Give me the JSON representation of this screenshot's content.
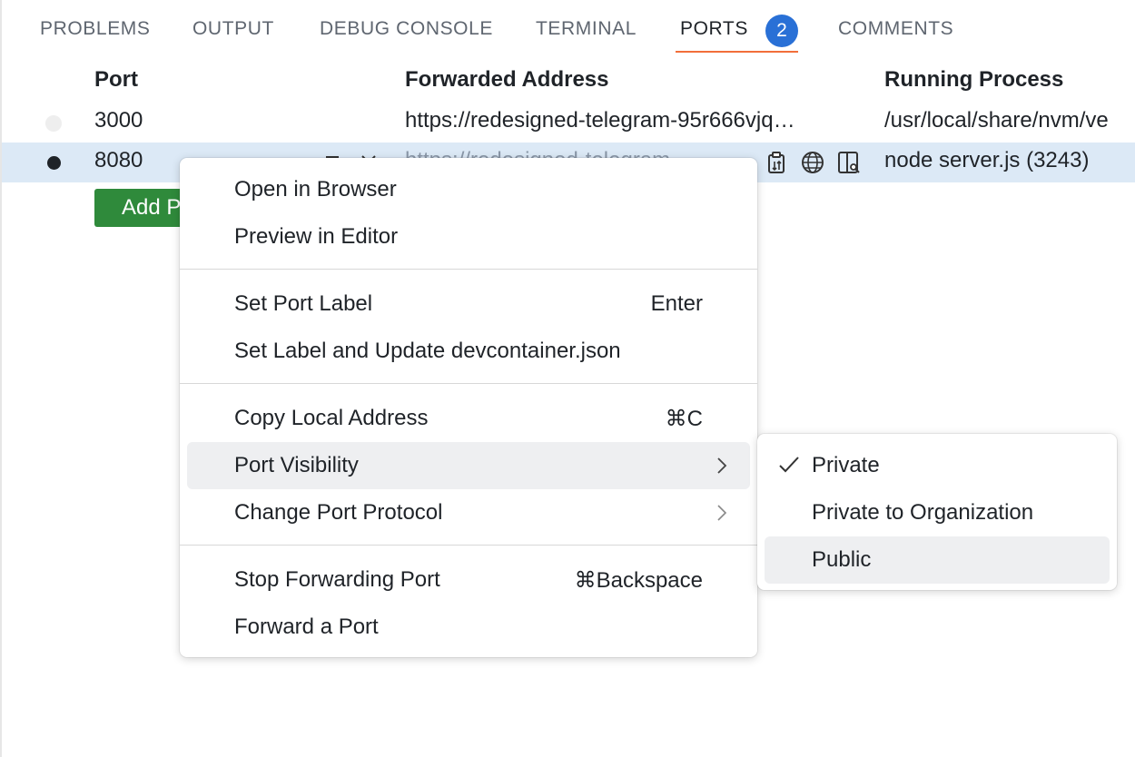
{
  "tabs": [
    {
      "label": "PROBLEMS"
    },
    {
      "label": "OUTPUT"
    },
    {
      "label": "DEBUG CONSOLE"
    },
    {
      "label": "TERMINAL"
    },
    {
      "label": "PORTS",
      "badge": "2"
    },
    {
      "label": "COMMENTS"
    }
  ],
  "active_tab": "PORTS",
  "table": {
    "headers": {
      "port": "Port",
      "address": "Forwarded Address",
      "process": "Running Process"
    },
    "rows": [
      {
        "port": "3000",
        "address": "https://redesigned-telegram-95r666vjq…",
        "process": "/usr/local/share/nvm/ve",
        "status": "idle"
      },
      {
        "port": "8080",
        "address": "https://redesigned-telegram-",
        "process": "node server.js (3243)",
        "status": "active",
        "selected": true
      }
    ],
    "add_button": "Add Port"
  },
  "context_menu": {
    "items": [
      {
        "label": "Open in Browser",
        "shortcut": ""
      },
      {
        "label": "Preview in Editor",
        "shortcut": ""
      },
      {
        "label": "Set Port Label",
        "shortcut": "Enter"
      },
      {
        "label": "Set Label and Update devcontainer.json",
        "shortcut": ""
      },
      {
        "label": "Copy Local Address",
        "shortcut": "⌘C"
      },
      {
        "label": "Port Visibility",
        "submenu": true,
        "highlighted": true
      },
      {
        "label": "Change Port Protocol",
        "submenu": true
      },
      {
        "label": "Stop Forwarding Port",
        "shortcut": "⌘Backspace"
      },
      {
        "label": "Forward a Port",
        "shortcut": ""
      }
    ]
  },
  "visibility_submenu": {
    "items": [
      {
        "label": "Private",
        "checked": true
      },
      {
        "label": "Private to Organization",
        "checked": false
      },
      {
        "label": "Public",
        "checked": false,
        "highlighted": true
      }
    ]
  },
  "colors": {
    "accent_underline": "#f26f3a",
    "badge": "#2970d6",
    "selected_row": "#dce9f6",
    "add_button": "#2f8a3b",
    "menu_hover": "#eeeff1"
  },
  "icons": [
    "open-in-browser-icon",
    "close-icon",
    "copy-address-icon",
    "globe-icon",
    "preview-icon",
    "checkmark-icon",
    "chevron-right-icon"
  ]
}
